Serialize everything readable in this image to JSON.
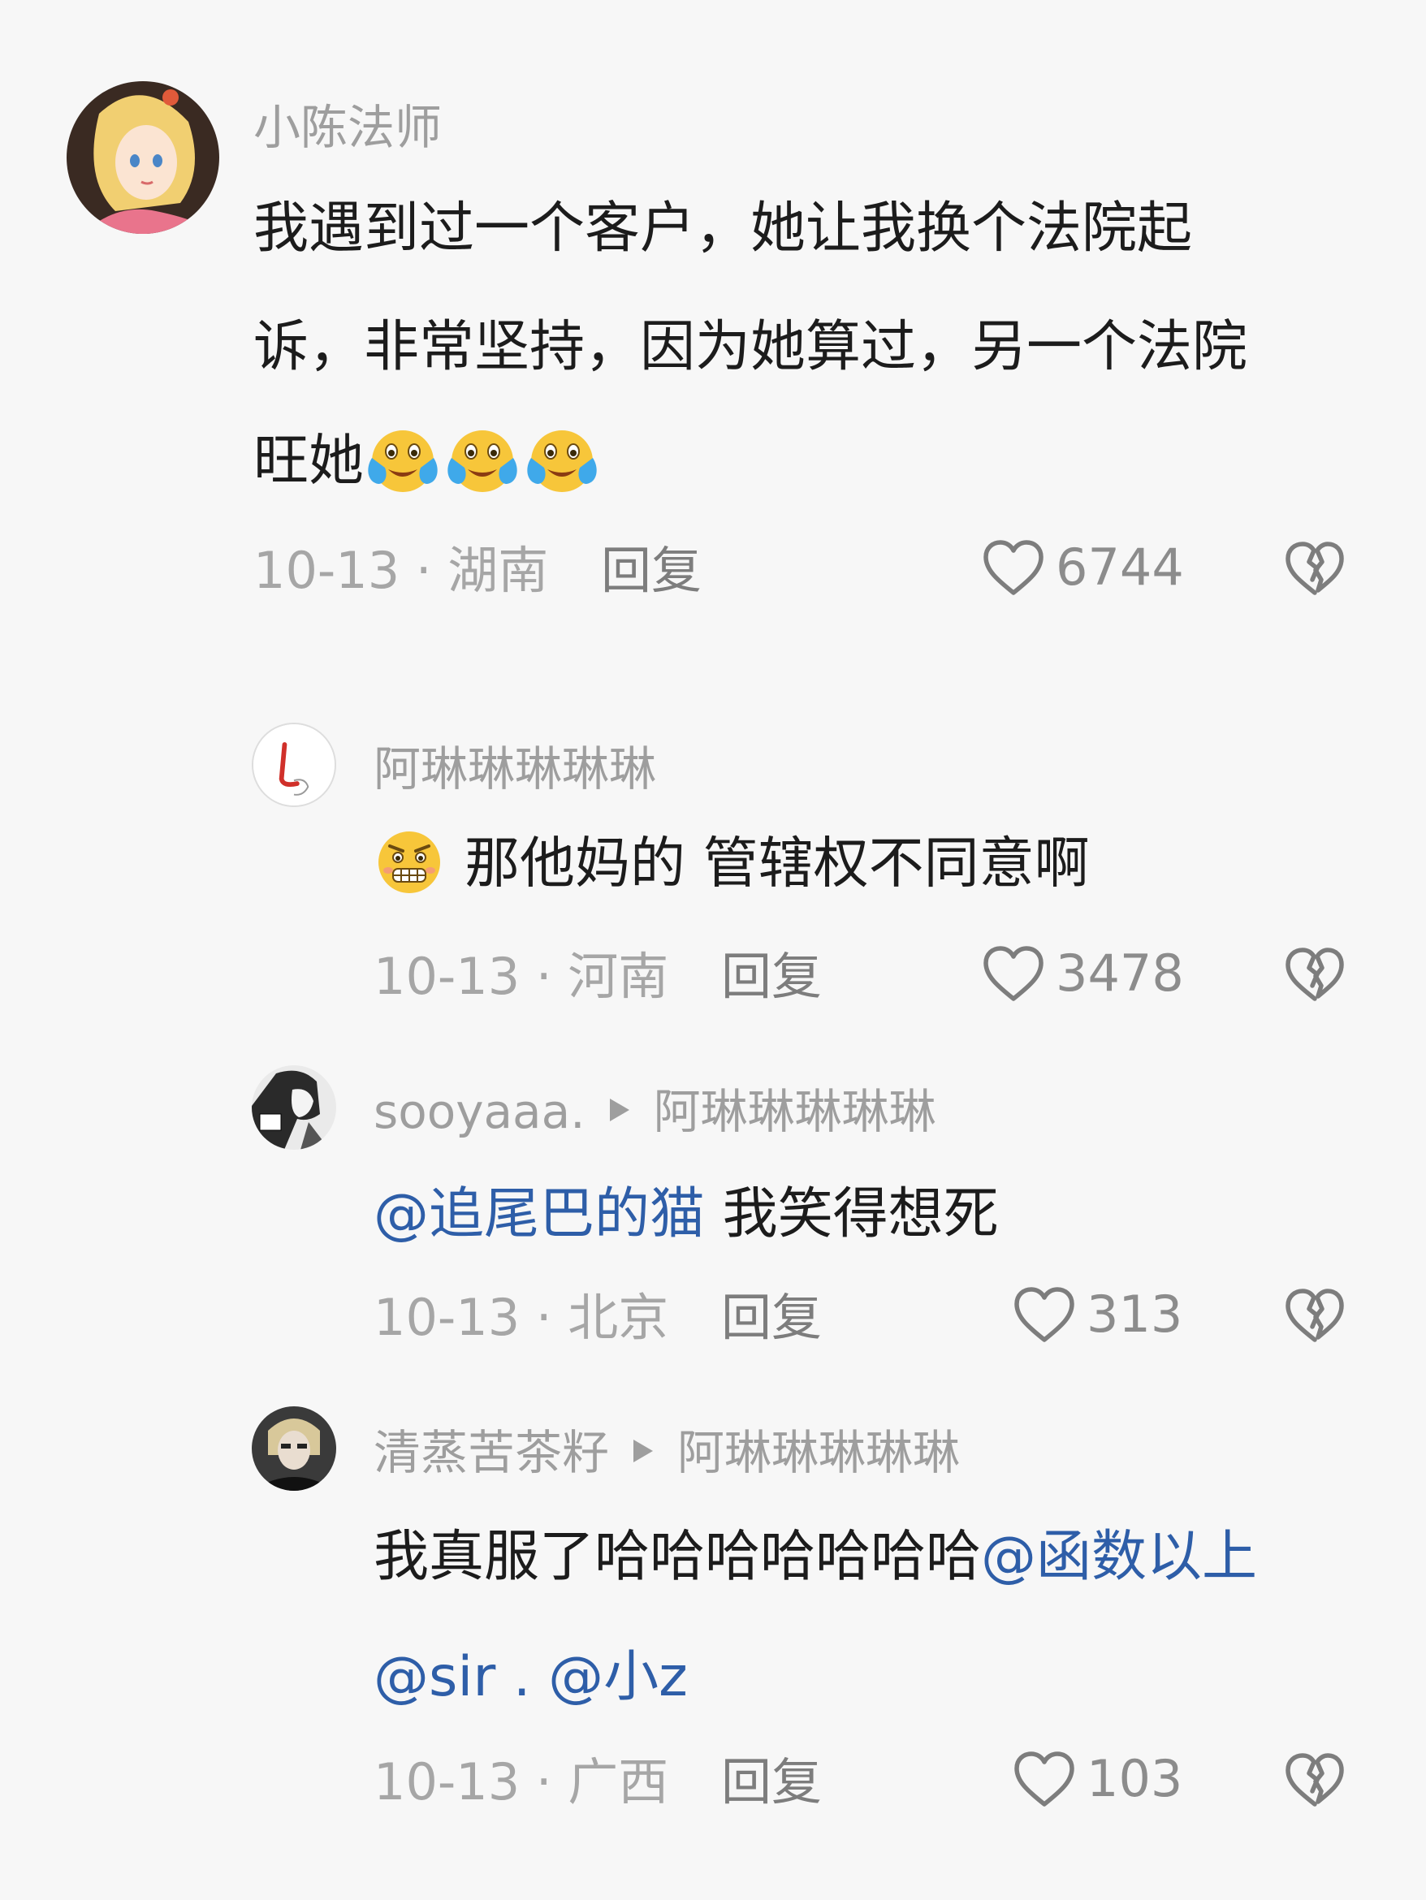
{
  "comments": [
    {
      "username": "小陈法师",
      "lines": [
        "我遇到过一个客户，她让我换个法院起",
        "诉，非常坚持，因为她算过，另一个法院",
        "旺她"
      ],
      "emoji": [
        "crying-laughing-emoji",
        "crying-laughing-emoji",
        "crying-laughing-emoji"
      ],
      "date": "10-13",
      "location": "湖南",
      "meta": "10-13 · 湖南",
      "reply_label": "回复",
      "likes": "6744"
    },
    {
      "username": "阿琳琳琳琳琳",
      "emoji": [
        "grimacing-face-emoji"
      ],
      "text": "那他妈的 管辖权不同意啊",
      "meta": "10-13 · 河南",
      "reply_label": "回复",
      "likes": "3478"
    },
    {
      "username": "sooyaaa.",
      "reply_to": "阿琳琳琳琳琳",
      "mention": "@追尾巴的猫",
      "text": " 我笑得想死",
      "meta": "10-13 · 北京",
      "reply_label": "回复",
      "likes": "313"
    },
    {
      "username": "清蒸苦茶籽",
      "reply_to": "阿琳琳琳琳琳",
      "text": "我真服了哈哈哈哈哈哈哈",
      "mention1": "@函数以上",
      "mention2": "@sir . @小z",
      "meta": "10-13 · 广西",
      "reply_label": "回复",
      "likes": "103"
    }
  ],
  "icons": {
    "like": "heart-outline-icon",
    "dislike": "broken-heart-icon",
    "reply_arrow": "triangle-right-icon"
  },
  "colors": {
    "background": "#f7f7f7",
    "mention": "#2e5ea8",
    "username": "#9e9e9e",
    "body_text": "#1c1c1c"
  }
}
